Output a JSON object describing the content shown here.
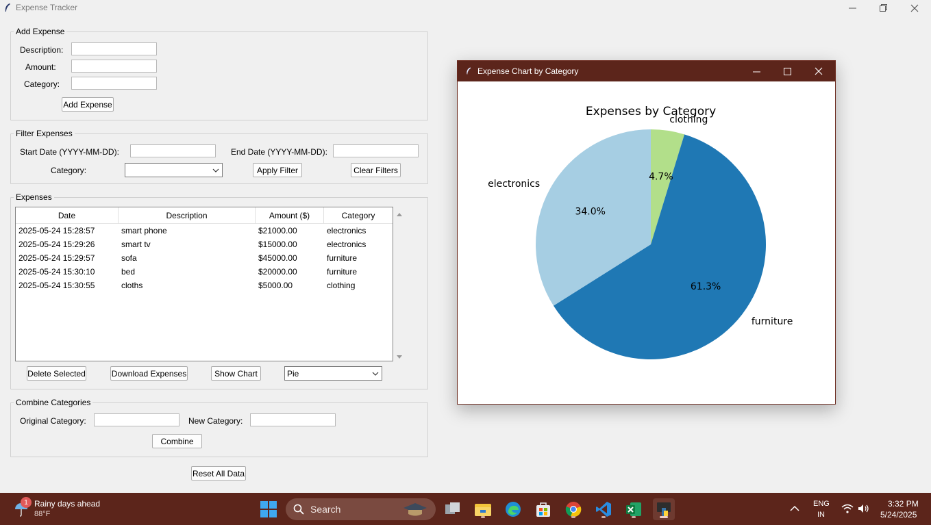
{
  "window": {
    "title": "Expense Tracker"
  },
  "add_expense": {
    "legend": "Add Expense",
    "description_label": "Description:",
    "amount_label": "Amount:",
    "category_label": "Category:",
    "description_value": "",
    "amount_value": "",
    "category_value": "",
    "button": "Add Expense"
  },
  "filter": {
    "legend": "Filter Expenses",
    "start_label": "Start Date (YYYY-MM-DD):",
    "end_label": "End Date (YYYY-MM-DD):",
    "category_label": "Category:",
    "start_value": "",
    "end_value": "",
    "category_value": "",
    "apply_button": "Apply Filter",
    "clear_button": "Clear Filters"
  },
  "expenses": {
    "legend": "Expenses",
    "columns": [
      "Date",
      "Description",
      "Amount ($)",
      "Category"
    ],
    "rows": [
      [
        "2025-05-24 15:28:57",
        "smart phone",
        "$21000.00",
        "electronics"
      ],
      [
        "2025-05-24 15:29:26",
        "smart tv",
        "$15000.00",
        "electronics"
      ],
      [
        "2025-05-24 15:29:57",
        "sofa",
        "$45000.00",
        "furniture"
      ],
      [
        "2025-05-24 15:30:10",
        "bed",
        "$20000.00",
        "furniture"
      ],
      [
        "2025-05-24 15:30:55",
        "cloths",
        "$5000.00",
        "clothing"
      ]
    ],
    "delete_button": "Delete Selected",
    "download_button": "Download Expenses",
    "chart_button": "Show Chart",
    "chart_type": "Pie"
  },
  "combine": {
    "legend": "Combine Categories",
    "original_label": "Original Category:",
    "new_label": "New Category:",
    "original_value": "",
    "new_value": "",
    "button": "Combine"
  },
  "reset_button": "Reset All Data",
  "chart_window": {
    "title": "Expense Chart by Category"
  },
  "chart_data": {
    "type": "pie",
    "title": "Expenses by Category",
    "slices": [
      {
        "label": "clothing",
        "value": 5000,
        "pct_label": "4.7%",
        "color": "#b2df8a"
      },
      {
        "label": "furniture",
        "value": 65000,
        "pct_label": "61.3%",
        "color": "#1f78b4"
      },
      {
        "label": "electronics",
        "value": 36000,
        "pct_label": "34.0%",
        "color": "#a6cee3"
      }
    ],
    "start_angle_deg": 90,
    "direction": "clockwise"
  },
  "taskbar": {
    "weather_badge": "1",
    "weather_title": "Rainy days ahead",
    "weather_temp": "88°F",
    "search_label": "Search",
    "lang_top": "ENG",
    "lang_bottom": "IN",
    "time": "3:32 PM",
    "date": "5/24/2025"
  }
}
